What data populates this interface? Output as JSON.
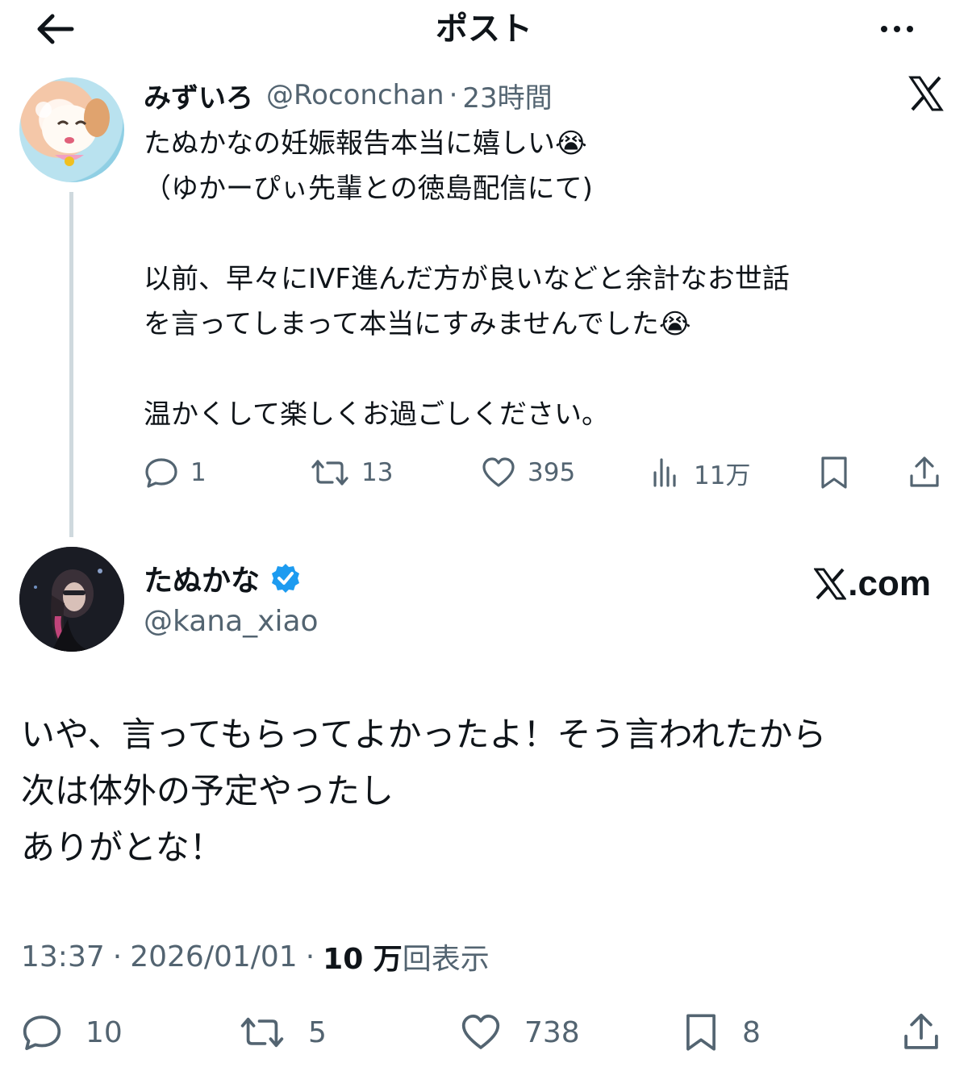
{
  "header": {
    "title": "ポスト",
    "back_icon": "arrow-left-icon",
    "more_icon": "more-horizontal-icon"
  },
  "reply_to": {
    "name": "みずいろ",
    "handle": "@Roconchan",
    "separator": "·",
    "time": "23時間",
    "body": "たぬかなの妊娠報告本当に嬉しい😭\n（ゆかーぴぃ先輩との徳島配信にて)\n\n以前、早々にIVF進んだ方が良いなどと余計なお世話\nを言ってしまって本当にすみませんでした😭\n\n温かくして楽しくお過ごしください。",
    "actions": {
      "replies": "1",
      "reposts": "13",
      "likes": "395",
      "views": "11万"
    }
  },
  "post": {
    "name": "たぬかな",
    "handle": "@kana_xiao",
    "verified": true,
    "watermark": ".com",
    "body": "いや、言ってもらってよかったよ！そう言われたから\n次は体外の予定やったし\nありがとな！",
    "time": "13:37",
    "separator": "·",
    "date": "2026/01/01",
    "views_count": "10 万",
    "views_label": "回表示",
    "actions": {
      "replies": "10",
      "reposts": "5",
      "likes": "738",
      "bookmarks": "8"
    }
  },
  "colors": {
    "text": "#0f1419",
    "secondary": "#536471",
    "verified_blue": "#1d9bf0",
    "thread_line": "#cfd9de"
  }
}
